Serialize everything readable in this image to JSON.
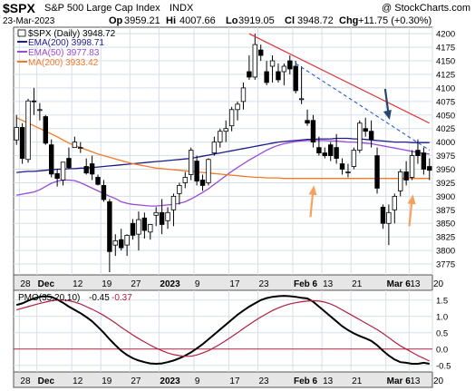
{
  "header": {
    "symbol": "$SPX",
    "name": "S&P 500 Large Cap Index",
    "exchange": "INDX",
    "watermark": "@ StockCharts.com",
    "date": "23-Mar-2023",
    "open_label": "Op",
    "open": "3959.21",
    "high_label": "Hi",
    "high": "4007.66",
    "low_label": "Lo",
    "low": "3919.05",
    "close_label": "Cl",
    "close": "3948.72",
    "change_label": "Chg",
    "change": "+11.75 (+0.30%)"
  },
  "legend": {
    "price": "$SPX (Daily) 3948.72",
    "ema200": "EMA(200) 3998.71",
    "ema50": "EMA(50) 3977.83",
    "ma200": "MA(200) 3933.42"
  },
  "pmo_legend": {
    "label": "PMO(35,20,10)",
    "value1": "-0.45",
    "value2": "-0.37"
  },
  "colors": {
    "up_candle": "#ffffff",
    "down_candle": "#000000",
    "ema200": "#1c1c8c",
    "ema50": "#9a4ad8",
    "ma200": "#f07a28",
    "trendline": "#e03030",
    "dashed_trend": "#2a5ad8",
    "pmo": "#000000",
    "pmo_signal": "#b02040",
    "arrow_blue": "#26456e",
    "arrow_orange": "#f5a35c",
    "grid": "#d5dfe9"
  },
  "chart_data": [
    {
      "type": "candlestick",
      "title": "$SPX (Daily) 3948.72",
      "x_labels": [
        "28",
        "Dec",
        "12",
        "19",
        "27",
        "2023",
        "9",
        "17",
        "23",
        "Feb 6",
        "13",
        "21",
        "Mar 6",
        "13",
        "20"
      ],
      "y_ticks": [
        3775,
        3800,
        3825,
        3850,
        3875,
        3900,
        3925,
        3950,
        3975,
        4000,
        4025,
        4050,
        4075,
        4100,
        4125,
        4150,
        4175,
        4200
      ],
      "ylim": [
        3755,
        4212
      ],
      "candles": [
        [
          4004,
          4050,
          3995,
          4027
        ],
        [
          4027,
          4035,
          3960,
          3970
        ],
        [
          3968,
          4080,
          3962,
          4076
        ],
        [
          4076,
          4100,
          4050,
          4075
        ],
        [
          4060,
          4072,
          4040,
          4060
        ],
        [
          4047,
          4050,
          3995,
          3998
        ],
        [
          3995,
          4005,
          3935,
          3941
        ],
        [
          3942,
          3950,
          3918,
          3933
        ],
        [
          3930,
          3963,
          3920,
          3963
        ],
        [
          3970,
          3990,
          3950,
          3953
        ],
        [
          3990,
          4010,
          3990,
          4000
        ],
        [
          3990,
          4000,
          3980,
          3990
        ],
        [
          3955,
          3970,
          3940,
          3943
        ],
        [
          3960,
          3975,
          3930,
          3941
        ],
        [
          3935,
          3940,
          3920,
          3922
        ],
        [
          3920,
          3930,
          3890,
          3894
        ],
        [
          3890,
          3895,
          3760,
          3798
        ],
        [
          3810,
          3830,
          3790,
          3818
        ],
        [
          3820,
          3840,
          3800,
          3805
        ],
        [
          3810,
          3830,
          3790,
          3828
        ],
        [
          3850,
          3858,
          3820,
          3828
        ],
        [
          3830,
          3872,
          3800,
          3857
        ],
        [
          3860,
          3870,
          3822,
          3837
        ],
        [
          3834,
          3848,
          3820,
          3848
        ],
        [
          3865,
          3880,
          3845,
          3870
        ],
        [
          3870,
          3895,
          3830,
          3848
        ],
        [
          3855,
          3880,
          3840,
          3870
        ],
        [
          3875,
          3905,
          3845,
          3900
        ],
        [
          3905,
          3925,
          3885,
          3920
        ],
        [
          3925,
          3945,
          3915,
          3935
        ],
        [
          3940,
          3990,
          3930,
          3985
        ],
        [
          3965,
          3975,
          3920,
          3928
        ],
        [
          3930,
          3940,
          3910,
          3920
        ],
        [
          3925,
          3970,
          3920,
          3968
        ],
        [
          3980,
          4010,
          3975,
          4000
        ],
        [
          4000,
          4025,
          3990,
          4020
        ],
        [
          4020,
          4040,
          4000,
          4025
        ],
        [
          4030,
          4065,
          4020,
          4060
        ],
        [
          4060,
          4075,
          4040,
          4070
        ],
        [
          4075,
          4110,
          4060,
          4100
        ],
        [
          4130,
          4160,
          4115,
          4120
        ],
        [
          4120,
          4200,
          4115,
          4180
        ],
        [
          4170,
          4180,
          4150,
          4160
        ],
        [
          4130,
          4150,
          4105,
          4110
        ],
        [
          4140,
          4160,
          4110,
          4150
        ],
        [
          4130,
          4145,
          4110,
          4115
        ],
        [
          4130,
          4145,
          4105,
          4140
        ],
        [
          4150,
          4160,
          4125,
          4135
        ],
        [
          4140,
          4150,
          4090,
          4095
        ],
        [
          4080,
          4140,
          4070,
          4080
        ],
        [
          4040,
          4060,
          4030,
          4035
        ],
        [
          4040,
          4050,
          3990,
          4000
        ],
        [
          3990,
          4010,
          3975,
          3980
        ],
        [
          3980,
          3990,
          3970,
          3975
        ],
        [
          3995,
          4000,
          3965,
          3975
        ],
        [
          3990,
          4015,
          3960,
          3970
        ],
        [
          3960,
          3970,
          3940,
          3950
        ],
        [
          3945,
          3960,
          3935,
          3945
        ],
        [
          3955,
          3990,
          3950,
          3985
        ],
        [
          3985,
          4040,
          3980,
          4035
        ],
        [
          4025,
          4045,
          4010,
          4020
        ],
        [
          4020,
          4040,
          3990,
          4005
        ],
        [
          3975,
          3990,
          3905,
          3915
        ],
        [
          3880,
          3885,
          3840,
          3850
        ],
        [
          3850,
          3885,
          3810,
          3870
        ],
        [
          3875,
          3905,
          3850,
          3900
        ],
        [
          3910,
          3950,
          3900,
          3945
        ],
        [
          3945,
          3965,
          3920,
          3930
        ],
        [
          3935,
          3985,
          3930,
          3975
        ],
        [
          3985,
          4005,
          3960,
          3975
        ],
        [
          3980,
          3990,
          3940,
          3950
        ],
        [
          3955,
          3970,
          3930,
          3948
        ]
      ],
      "series": [
        {
          "name": "EMA(200) 3998.71",
          "values": [
            3944,
            3945,
            3946,
            3946,
            3947,
            3948,
            3949,
            3950,
            3950,
            3951,
            3951,
            3952,
            3952,
            3953,
            3954,
            3955,
            3956,
            3957,
            3958,
            3959,
            3960,
            3961,
            3962,
            3963,
            3964,
            3965,
            3966,
            3967,
            3968,
            3969,
            3970,
            3972,
            3974,
            3976,
            3978,
            3980,
            3982,
            3984,
            3986,
            3988,
            3990,
            3992,
            3994,
            3996,
            3998,
            4000,
            4001,
            4002,
            4003,
            4004,
            4005,
            4005,
            4006,
            4006,
            4006,
            4007,
            4007,
            4007,
            4006,
            4006,
            4005,
            4004,
            4003,
            4002,
            4001,
            4000,
            4000,
            4000,
            3999,
            3999,
            3999,
            3999
          ]
        },
        {
          "name": "EMA(50) 3977.83",
          "values": [
            3902,
            3904,
            3906,
            3908,
            3912,
            3918,
            3924,
            3928,
            3930,
            3930,
            3929,
            3925,
            3920,
            3915,
            3910,
            3905,
            3900,
            3896,
            3890,
            3887,
            3885,
            3884,
            3883,
            3882,
            3882,
            3883,
            3884,
            3885,
            3887,
            3890,
            3895,
            3901,
            3907,
            3914,
            3922,
            3930,
            3938,
            3946,
            3953,
            3960,
            3967,
            3973,
            3979,
            3985,
            3990,
            3994,
            3997,
            3999,
            4001,
            4002,
            4003,
            4003,
            4003,
            4003,
            4002,
            4002,
            4001,
            4000,
            4000,
            3999,
            3998,
            3997,
            3995,
            3993,
            3991,
            3989,
            3987,
            3985,
            3983,
            3981,
            3979,
            3978
          ]
        },
        {
          "name": "MA(200) 3933.42",
          "values": [
            4045,
            4040,
            4035,
            4030,
            4025,
            4020,
            4015,
            4010,
            4004,
            3998,
            3994,
            3990,
            3986,
            3982,
            3978,
            3975,
            3972,
            3969,
            3966,
            3963,
            3960,
            3958,
            3956,
            3954,
            3952,
            3951,
            3950,
            3949,
            3948,
            3947,
            3946,
            3945,
            3944,
            3943,
            3942,
            3941,
            3940,
            3939,
            3938,
            3937,
            3936,
            3935,
            3935,
            3934,
            3934,
            3934,
            3933,
            3933,
            3933,
            3933,
            3933,
            3933,
            3933,
            3933,
            3933,
            3933,
            3933,
            3933,
            3933,
            3933,
            3933,
            3933,
            3933,
            3933,
            3933,
            3933,
            3933,
            3933,
            3933,
            3933,
            3933,
            3933
          ]
        }
      ],
      "annotations": {
        "trendline_solid": {
          "from": [
            40,
            4200
          ],
          "to": [
            71,
            4035
          ]
        },
        "trendline_dashed": {
          "from": [
            48,
            4145
          ],
          "to": [
            71,
            3985
          ]
        },
        "arrows": [
          {
            "kind": "down",
            "color": "blue",
            "at": [
              64,
              4048
            ]
          },
          {
            "kind": "up",
            "color": "orange",
            "at": [
              51,
              3912
            ]
          },
          {
            "kind": "up",
            "color": "orange",
            "at": [
              68,
              3895
            ]
          }
        ]
      }
    },
    {
      "type": "line",
      "title": "PMO(35,20,10) -0.45, -0.37",
      "y_ticks": [
        -0.5,
        0.0,
        0.5,
        1.0,
        1.5
      ],
      "ylim": [
        -0.7,
        1.8
      ],
      "zero_line": 0,
      "series": [
        {
          "name": "PMO",
          "values": [
            1.35,
            1.4,
            1.48,
            1.55,
            1.6,
            1.62,
            1.6,
            1.52,
            1.42,
            1.3,
            1.2,
            1.1,
            0.98,
            0.85,
            0.68,
            0.5,
            0.3,
            0.12,
            -0.05,
            -0.18,
            -0.28,
            -0.35,
            -0.4,
            -0.44,
            -0.45,
            -0.44,
            -0.4,
            -0.35,
            -0.28,
            -0.2,
            -0.1,
            0.02,
            0.15,
            0.3,
            0.45,
            0.6,
            0.75,
            0.9,
            1.05,
            1.18,
            1.3,
            1.4,
            1.5,
            1.56,
            1.6,
            1.62,
            1.63,
            1.62,
            1.6,
            1.57,
            1.55,
            1.45,
            1.3,
            1.15,
            1.0,
            0.85,
            0.7,
            0.58,
            0.48,
            0.4,
            0.33,
            0.25,
            0.12,
            -0.05,
            -0.2,
            -0.32,
            -0.4,
            -0.42,
            -0.45,
            -0.45,
            -0.42,
            -0.45
          ]
        },
        {
          "name": "Signal",
          "values": [
            1.2,
            1.25,
            1.3,
            1.35,
            1.4,
            1.44,
            1.48,
            1.5,
            1.5,
            1.48,
            1.44,
            1.38,
            1.3,
            1.22,
            1.13,
            1.03,
            0.92,
            0.8,
            0.67,
            0.55,
            0.43,
            0.32,
            0.22,
            0.12,
            0.03,
            -0.05,
            -0.12,
            -0.17,
            -0.2,
            -0.22,
            -0.22,
            -0.18,
            -0.12,
            -0.05,
            0.05,
            0.15,
            0.26,
            0.38,
            0.5,
            0.63,
            0.75,
            0.87,
            0.98,
            1.08,
            1.18,
            1.26,
            1.33,
            1.38,
            1.42,
            1.45,
            1.47,
            1.48,
            1.47,
            1.44,
            1.38,
            1.3,
            1.2,
            1.1,
            1.0,
            0.9,
            0.8,
            0.7,
            0.6,
            0.48,
            0.35,
            0.22,
            0.1,
            0.0,
            -0.1,
            -0.2,
            -0.28,
            -0.37
          ]
        }
      ]
    }
  ]
}
